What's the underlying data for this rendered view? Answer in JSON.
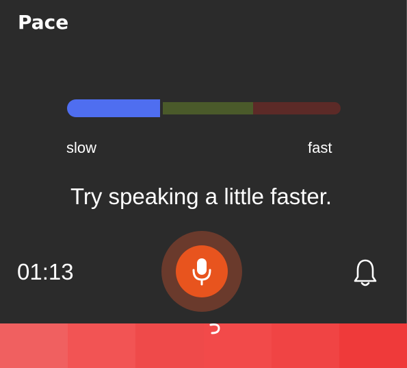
{
  "panel": {
    "title": "Pace",
    "pace_meter": {
      "label_slow": "slow",
      "label_fast": "fast",
      "current_pace_fraction": 0.34,
      "colors": {
        "slow": "#4f6ef0",
        "medium": "#4a5a2a",
        "fast": "#5c2a27"
      }
    },
    "message": "Try speaking a little faster.",
    "elapsed_time": "01:13",
    "mic_button": {
      "icon": "microphone-icon",
      "color": "#e8541e",
      "halo_color": "#6a3a2c"
    },
    "notification_icon": "bell-icon"
  },
  "background_strip": {
    "colors": [
      "#f06060",
      "#f25454",
      "#ef4a4a",
      "#f24a4a",
      "#f04444",
      "#ef3a3a"
    ]
  }
}
